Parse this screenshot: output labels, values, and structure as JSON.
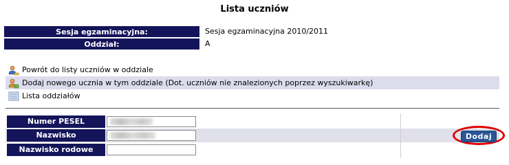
{
  "page": {
    "title": "Lista uczniów"
  },
  "info": [
    {
      "label": "Sesja egzaminacyjna:",
      "value": "Sesja egzaminacyjna 2010/2011"
    },
    {
      "label": "Oddział:",
      "value": "A"
    }
  ],
  "links": [
    {
      "icon": "user-back-icon",
      "label": "Powrót do listy uczniów w oddziale"
    },
    {
      "icon": "user-add-icon",
      "label": "Dodaj nowego ucznia w tym oddziale (Dot. uczniów nie znalezionych poprzez wyszukiwarkę)"
    },
    {
      "icon": "list-icon",
      "label": "Lista oddziałów"
    }
  ],
  "form": {
    "fields": [
      {
        "label": "Numer PESEL",
        "value": ""
      },
      {
        "label": "Nazwisko",
        "value": ""
      },
      {
        "label": "Nazwisko rodowe",
        "value": ""
      }
    ],
    "submit_label": "Dodaj"
  },
  "colors": {
    "header_bg": "#14145a",
    "button_bg": "#2b5596",
    "highlight_ring": "#e00000",
    "alt_row": "#dcdcec"
  }
}
